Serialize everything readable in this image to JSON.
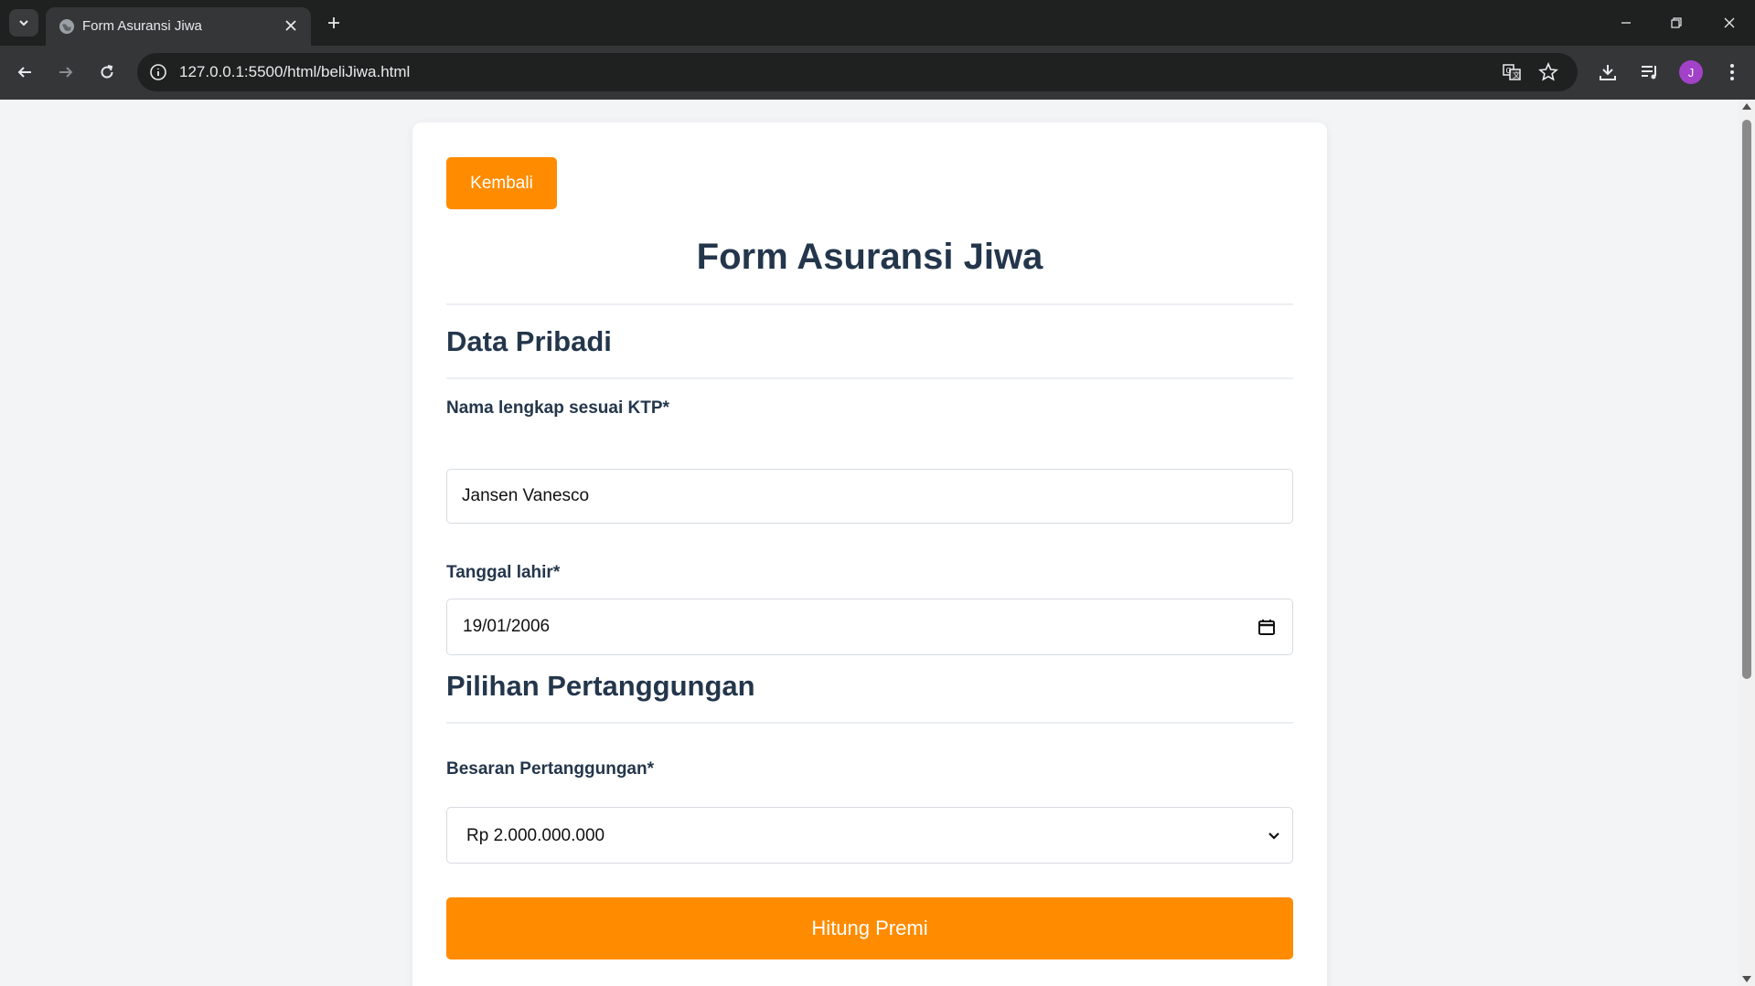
{
  "browser": {
    "tab_title": "Form Asuransi Jiwa",
    "url": "127.0.0.1:5500/html/beliJiwa.html",
    "avatar_initial": "J"
  },
  "page": {
    "back_label": "Kembali",
    "title": "Form Asuransi Jiwa",
    "sections": {
      "personal": {
        "title": "Data Pribadi",
        "name_label": "Nama lengkap sesuai KTP*",
        "name_value": "Jansen Vanesco",
        "dob_label": "Tanggal lahir*",
        "dob_value": "19/01/2006"
      },
      "coverage": {
        "title": "Pilihan Pertanggungan",
        "amount_label": "Besaran Pertanggungan*",
        "amount_value": "Rp 2.000.000.000"
      }
    },
    "submit_label": "Hitung Premi"
  },
  "colors": {
    "accent": "#ff8c00",
    "heading": "#24364b",
    "page_bg": "#f3f4f6"
  }
}
